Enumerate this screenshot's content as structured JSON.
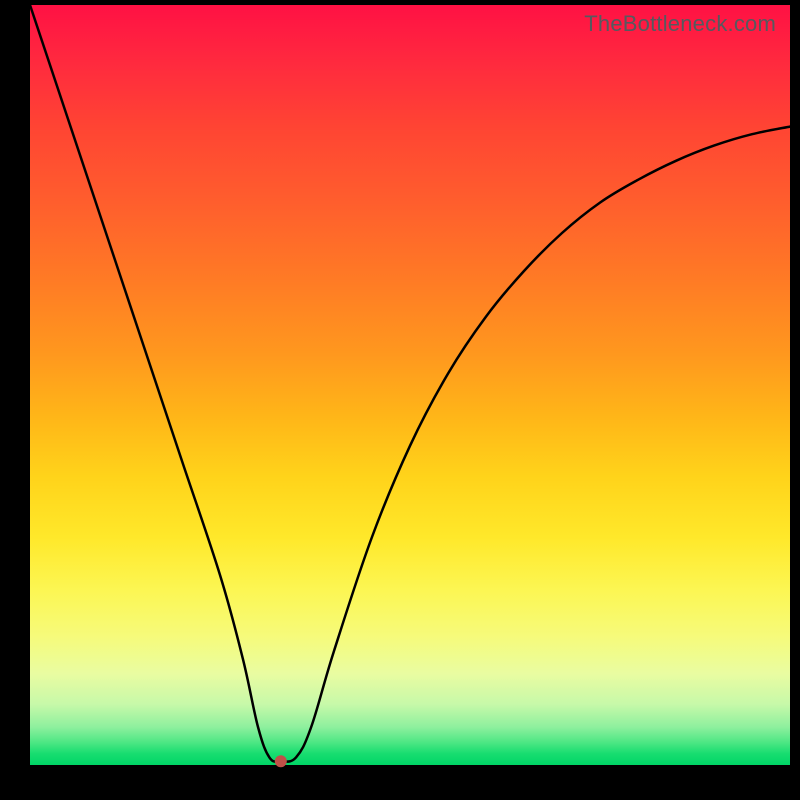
{
  "watermark": "TheBottleneck.com",
  "chart_data": {
    "type": "line",
    "title": "",
    "xlabel": "",
    "ylabel": "",
    "xlim": [
      0,
      100
    ],
    "ylim": [
      0,
      100
    ],
    "grid": false,
    "series": [
      {
        "name": "curve",
        "x": [
          0,
          5,
          10,
          15,
          20,
          25,
          28,
          30,
          31.5,
          33,
          35,
          37,
          40,
          45,
          50,
          55,
          60,
          65,
          70,
          75,
          80,
          85,
          90,
          95,
          100
        ],
        "values": [
          100,
          85,
          70,
          55,
          40,
          25,
          14,
          5,
          1,
          0.5,
          1,
          5,
          15,
          30,
          42,
          51.5,
          59,
          65,
          70,
          74,
          77,
          79.5,
          81.5,
          83,
          84
        ]
      }
    ],
    "marker": {
      "x": 33,
      "y": 0.5,
      "color": "#c05048",
      "radius_px": 6
    }
  },
  "colors": {
    "curve_stroke": "#000000",
    "frame_bg": "#000000"
  }
}
